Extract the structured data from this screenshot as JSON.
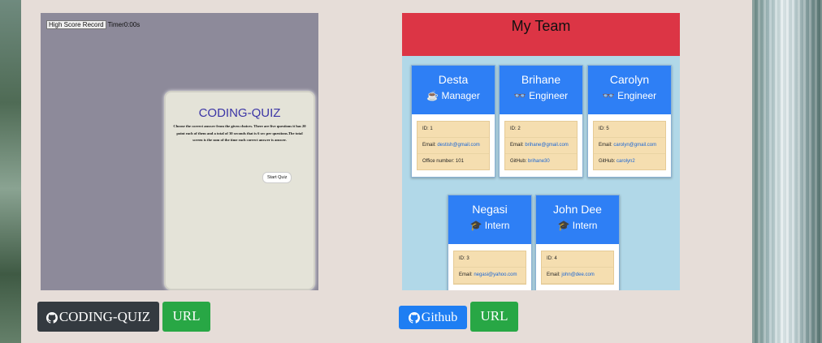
{
  "projects": [
    {
      "preview": {
        "high_score_label": "High Score Record",
        "timer_label": "Timer0:00s",
        "quiz_title": "CODING-QUIZ",
        "quiz_description": "Choose the correct answer from the given choices. There are five questions it has 20 point each of them and a total of 30 seconds that is 6 sec per questions.The total screen is the sum of the time each correct answer is answer.",
        "start_label": "Start Quiz"
      },
      "repo_button": "CODING-QUIZ",
      "url_button": "URL"
    },
    {
      "preview": {
        "header": "My Team",
        "members": [
          {
            "name": "Desta",
            "role": "Manager",
            "icon": "coffee-icon",
            "id": "ID: 1",
            "email_label": "Email: ",
            "email": "destish@gmail.com",
            "extra_label": "Office number: 101",
            "extra_link": ""
          },
          {
            "name": "Brihane",
            "role": "Engineer",
            "icon": "glasses-icon",
            "id": "ID: 2",
            "email_label": "Email: ",
            "email": "brihane@gmail.com",
            "extra_label": "GitHub: ",
            "extra_link": "brihane30"
          },
          {
            "name": "Carolyn",
            "role": "Engineer",
            "icon": "glasses-icon",
            "id": "ID: 5",
            "email_label": "Email: ",
            "email": "carolyn@gmail.com",
            "extra_label": "GitHub: ",
            "extra_link": "carolyn2"
          },
          {
            "name": "Negasi",
            "role": "Intern",
            "icon": "graduate-icon",
            "id": "ID: 3",
            "email_label": "Email: ",
            "email": "negasi@yahoo.com",
            "extra_label": "",
            "extra_link": ""
          },
          {
            "name": "John Dee",
            "role": "Intern",
            "icon": "graduate-icon",
            "id": "ID: 4",
            "email_label": "Email: ",
            "email": "john@dee.com",
            "extra_label": "",
            "extra_link": ""
          }
        ]
      },
      "repo_button": "Github",
      "url_button": "URL"
    }
  ],
  "colors": {
    "dark_button": "#343a40",
    "green_button": "#28a745",
    "blue_button": "#1e7ef3",
    "team_header": "#dc3545",
    "card_header": "#2e7ff5"
  }
}
